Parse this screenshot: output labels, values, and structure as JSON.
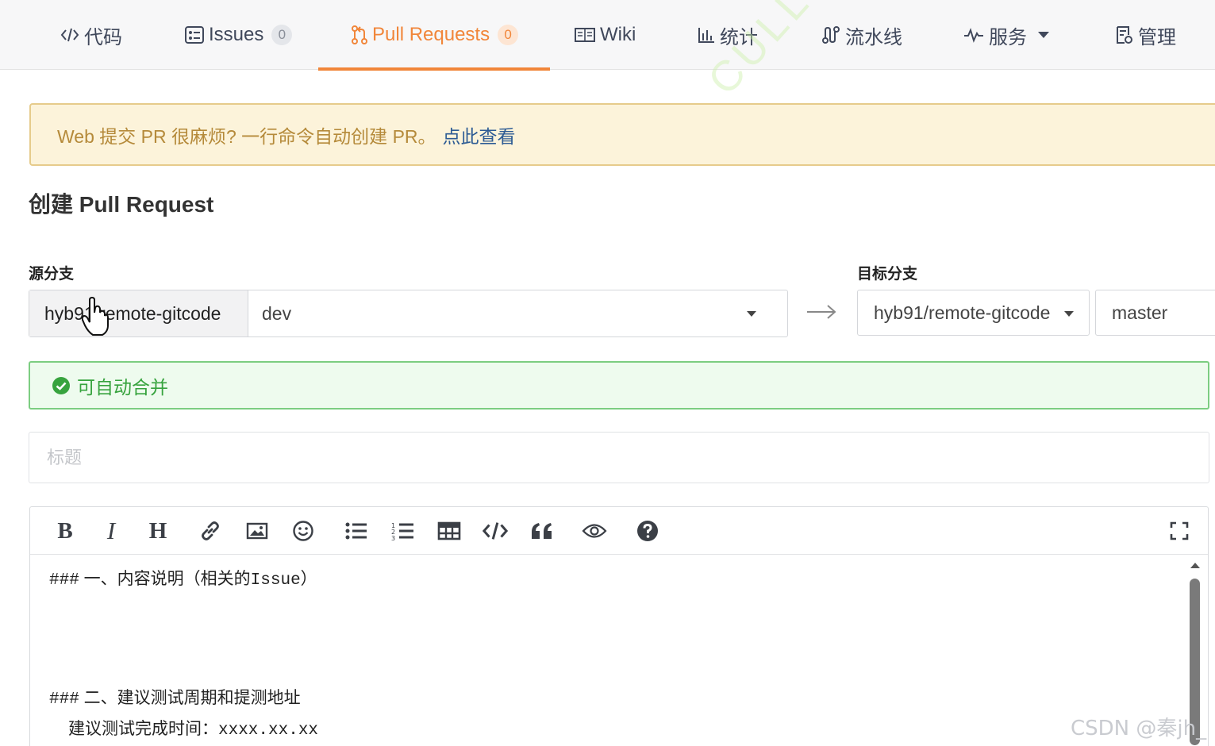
{
  "tabs": [
    {
      "label": "代码",
      "icon": "code-icon"
    },
    {
      "label": "Issues",
      "count": "0",
      "icon": "issues-icon"
    },
    {
      "label": "Pull Requests",
      "count": "0",
      "icon": "pull-request-icon",
      "active": true
    },
    {
      "label": "Wiki",
      "icon": "wiki-icon"
    },
    {
      "label": "统计",
      "icon": "stats-icon"
    },
    {
      "label": "流水线",
      "icon": "pipeline-icon"
    },
    {
      "label": "服务",
      "icon": "pulse-icon"
    },
    {
      "label": "管理",
      "icon": "manage-icon"
    }
  ],
  "notice": {
    "text": "Web 提交 PR 很麻烦? 一行命令自动创建 PR。",
    "link": "点此查看"
  },
  "page_title": "创建 Pull Request",
  "source": {
    "label": "源分支",
    "repo": "hyb91/remote-gitcode",
    "branch": "dev"
  },
  "target": {
    "label": "目标分支",
    "repo": "hyb91/remote-gitcode",
    "branch": "master"
  },
  "merge_status": "可自动合并",
  "title_placeholder": "标题",
  "editor": {
    "line1_hash": "###",
    "line1_text": " 一、内容说明（相关的",
    "line1_code": "Issue",
    "line1_end": "）",
    "line2_hash": "###",
    "line2_text": " 二、建议测试周期和提测地址",
    "line3_text": "建议测试完成时间：",
    "line3_code": "xxxx.xx.xx"
  },
  "watermark": "CSDN @秦jh_",
  "diagonal_watermark": "CULLY.YU",
  "colors": {
    "accent": "#f1863a",
    "success": "#37a33e",
    "notice_bg": "#fcf3da",
    "link": "#2d5b94"
  }
}
